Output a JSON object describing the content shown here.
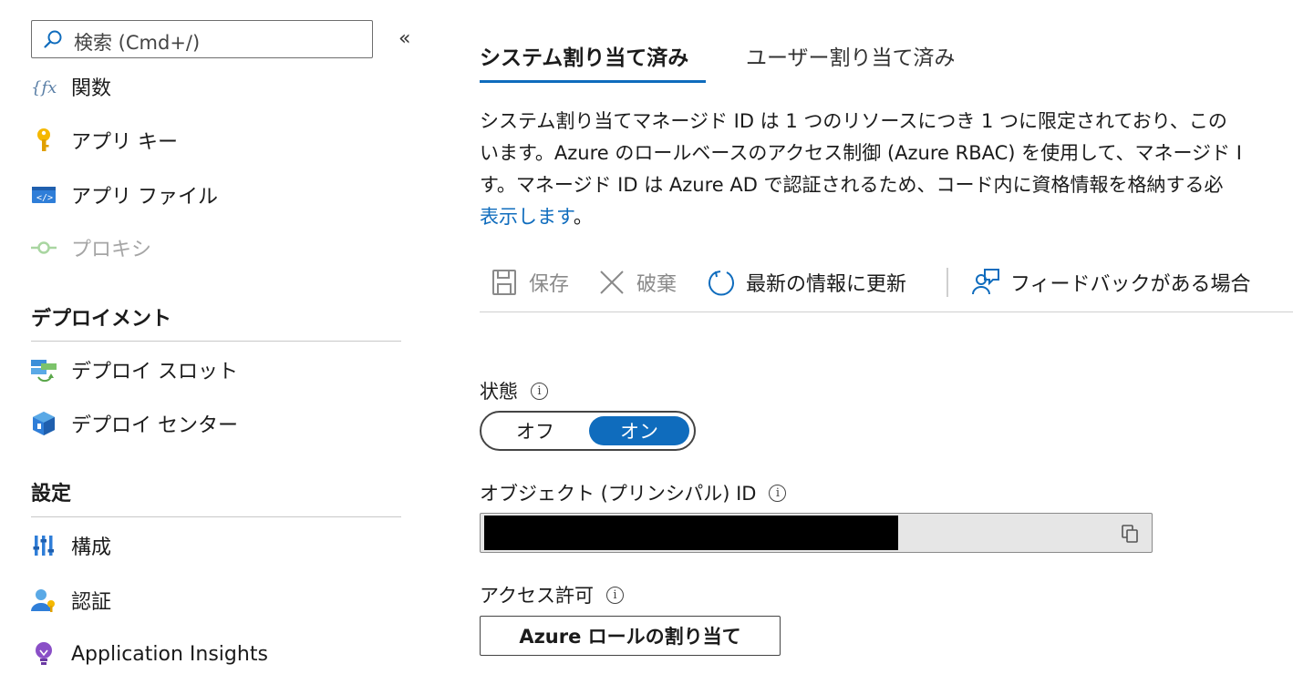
{
  "sidebar": {
    "search_placeholder": "検索 (Cmd+/)",
    "collapse_glyph": "«",
    "top_items": [
      {
        "label": "関数",
        "icon": "function-icon"
      },
      {
        "label": "アプリ キー",
        "icon": "key-icon"
      },
      {
        "label": "アプリ ファイル",
        "icon": "code-file-icon"
      },
      {
        "label": "プロキシ",
        "icon": "proxy-icon",
        "disabled": true
      }
    ],
    "deploy_heading": "デプロイメント",
    "deploy_items": [
      {
        "label": "デプロイ スロット",
        "icon": "deployment-slots-icon"
      },
      {
        "label": "デプロイ センター",
        "icon": "deployment-center-icon"
      }
    ],
    "settings_heading": "設定",
    "settings_items": [
      {
        "label": "構成",
        "icon": "configuration-icon"
      },
      {
        "label": "認証",
        "icon": "authentication-icon"
      },
      {
        "label": "Application Insights",
        "icon": "lightbulb-icon"
      }
    ]
  },
  "tabs": [
    {
      "label": "システム割り当て済み",
      "active": true
    },
    {
      "label": "ユーザー割り当て済み",
      "active": false
    }
  ],
  "description": {
    "line1": "システム割り当てマネージド ID は 1 つのリソースにつき 1 つに限定されており、この",
    "line2": "います。Azure のロールベースのアクセス制御 (Azure RBAC) を使用して、マネージド I",
    "line3": "す。マネージド ID は Azure AD で認証されるため、コード内に資格情報を格納する必",
    "link": "表示します",
    "tail": "。"
  },
  "toolbar": {
    "save": "保存",
    "discard": "破棄",
    "refresh": "最新の情報に更新",
    "feedback": "フィードバックがある場合"
  },
  "status": {
    "label": "状態",
    "off": "オフ",
    "on": "オン",
    "value": "オン"
  },
  "object_id": {
    "label": "オブジェクト (プリンシパル) ID"
  },
  "permissions": {
    "label": "アクセス許可",
    "button": "Azure ロールの割り当て"
  },
  "colors": {
    "accent": "#0f6cbd",
    "disabled_text": "#a5a5a5"
  }
}
